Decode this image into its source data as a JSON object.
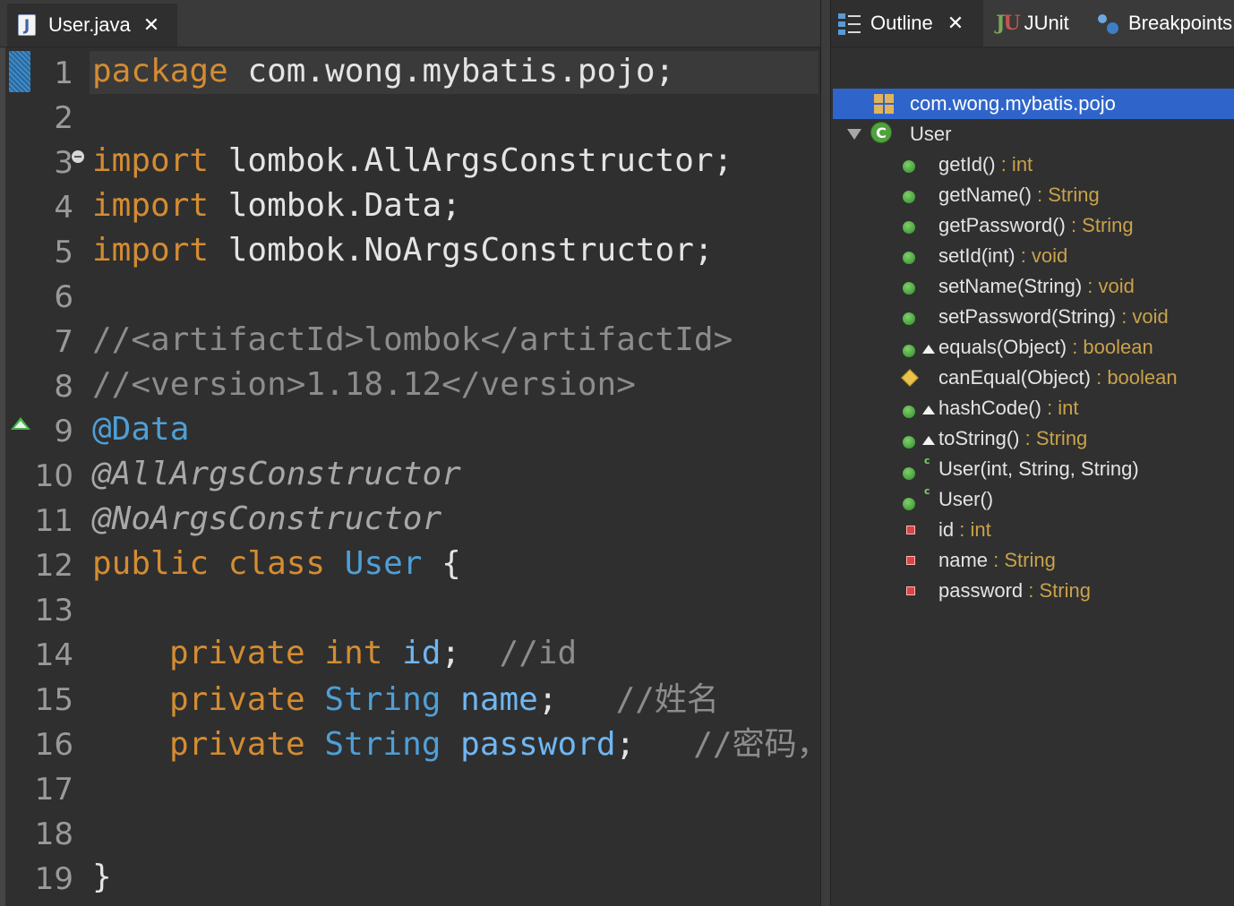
{
  "editor": {
    "tab": {
      "title": "User.java",
      "icon": "java-file-icon",
      "close_icon": "close-icon"
    },
    "line_numbers": [
      "1",
      "2",
      "3",
      "4",
      "5",
      "6",
      "7",
      "8",
      "9",
      "10",
      "11",
      "12",
      "13",
      "14",
      "15",
      "16",
      "17",
      "18",
      "19"
    ],
    "code": {
      "l1_kw": "package",
      "l1_rest": " com.wong.mybatis.pojo;",
      "l3_kw": "import",
      "l3_rest": " lombok.AllArgsConstructor;",
      "l4_kw": "import",
      "l4_rest": " lombok.Data;",
      "l5_kw": "import",
      "l5_rest": " lombok.NoArgsConstructor;",
      "l7": "//<artifactId>lombok</artifactId>",
      "l8": "//<version>1.18.12</version>",
      "l9": "@Data",
      "l10": "@AllArgsConstructor",
      "l11": "@NoArgsConstructor",
      "l12_kw": "public class",
      "l12_cls": "User",
      "l12_rest": " {",
      "l14_kw": "private",
      "l14_type": "int",
      "l14_field": "id",
      "l14_semi": ";",
      "l14_cmt": "//id",
      "l15_kw": "private",
      "l15_type": "String",
      "l15_field": "name",
      "l15_semi": ";",
      "l15_cmt": "//姓名",
      "l16_kw": "private",
      "l16_type": "String",
      "l16_field": "password",
      "l16_semi": ";",
      "l16_cmt": "//密码，",
      "l19": "}"
    }
  },
  "outline": {
    "tabs": [
      {
        "label": "Outline",
        "icon": "outline-icon",
        "close_icon": "close-icon"
      },
      {
        "label": "JUnit",
        "icon": "junit-icon"
      },
      {
        "label": "Breakpoints",
        "icon": "breakpoints-icon"
      }
    ],
    "package": "com.wong.mybatis.pojo",
    "class_name": "User",
    "members": [
      {
        "name": "getId()",
        "type": " : int",
        "icon": "public-method-icon"
      },
      {
        "name": "getName()",
        "type": " : String",
        "icon": "public-method-icon"
      },
      {
        "name": "getPassword()",
        "type": " : String",
        "icon": "public-method-icon"
      },
      {
        "name": "setId(int)",
        "type": " : void",
        "icon": "public-method-icon"
      },
      {
        "name": "setName(String)",
        "type": " : void",
        "icon": "public-method-icon"
      },
      {
        "name": "setPassword(String)",
        "type": " : void",
        "icon": "public-method-icon"
      },
      {
        "name": "equals(Object)",
        "type": " : boolean",
        "icon": "override-method-icon"
      },
      {
        "name": "canEqual(Object)",
        "type": " : boolean",
        "icon": "protected-method-icon"
      },
      {
        "name": "hashCode()",
        "type": " : int",
        "icon": "override-method-icon"
      },
      {
        "name": "toString()",
        "type": " : String",
        "icon": "override-method-icon"
      },
      {
        "name": "User(int, String, String)",
        "type": "",
        "icon": "constructor-icon"
      },
      {
        "name": "User()",
        "type": "",
        "icon": "constructor-icon"
      },
      {
        "name": "id",
        "type": " : int",
        "icon": "private-field-icon"
      },
      {
        "name": "name",
        "type": " : String",
        "icon": "private-field-icon"
      },
      {
        "name": "password",
        "type": " : String",
        "icon": "private-field-icon"
      }
    ]
  }
}
